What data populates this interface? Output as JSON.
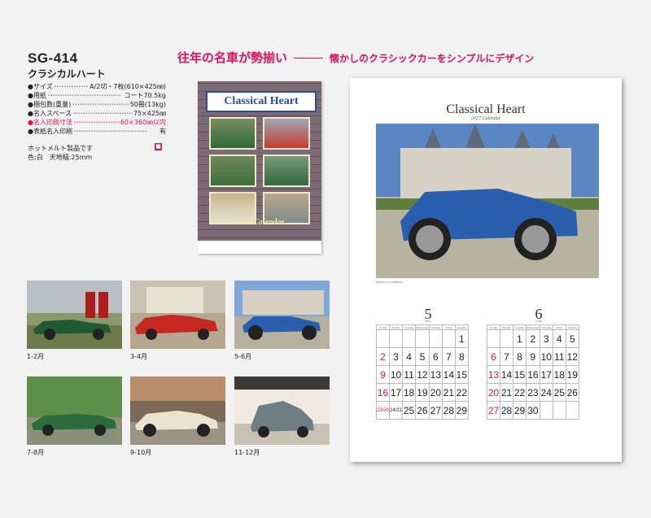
{
  "product": {
    "code": "SG-414",
    "name": "クラシカルハート"
  },
  "specs": [
    {
      "k": "●サイズ",
      "v": "A/2切・7枚(610×425㎜)",
      "pink": false
    },
    {
      "k": "●用紙",
      "v": "コート70.5kg",
      "pink": false
    },
    {
      "k": "●梱包数(重量)",
      "v": "50冊(13kg)",
      "pink": false
    },
    {
      "k": "●名入スペース",
      "v": "75×425㎜",
      "pink": false
    },
    {
      "k": "●名入印刷寸法",
      "v": "60×360㎜以内",
      "pink": true
    },
    {
      "k": "●表紙名入印刷",
      "v": "有",
      "pink": false
    }
  ],
  "notes": {
    "line1": "ホットメルト製品です",
    "line2": "色:白　天地幅:25mm",
    "tag": "■"
  },
  "headline": {
    "main": "往年の名車が勢揃い",
    "sub": "懐かしのクラシックカーをシンプルにデザイン"
  },
  "cover": {
    "title": "Classical Heart",
    "year": "2027 Calendar"
  },
  "thumbs": [
    "1-2月",
    "3-4月",
    "5-6月",
    "7-8月",
    "9-10月",
    "11-12月"
  ],
  "calendar": {
    "title": "Classical Heart",
    "subtitle": "2027 Calendar",
    "caption_left": "BUGATTI T35 BRESCIA",
    "caption_right": "",
    "weekdays": [
      "Sunday",
      "Monday",
      "Tuesday",
      "Wednesday",
      "Thursday",
      "Friday",
      "Saturday"
    ],
    "may": {
      "num": "5",
      "label": "MAY",
      "rows": [
        [
          "",
          "",
          "",
          "",
          "",
          "",
          "1"
        ],
        [
          "2",
          "3",
          "4",
          "5",
          "6",
          "7",
          "8"
        ],
        [
          "9",
          "10",
          "11",
          "12",
          "13",
          "14",
          "15"
        ],
        [
          "16",
          "17",
          "18",
          "19",
          "20",
          "21",
          "22"
        ],
        [
          "23/30",
          "24/31",
          "25",
          "26",
          "27",
          "28",
          "29"
        ]
      ]
    },
    "june": {
      "num": "6",
      "label": "JUNE",
      "rows": [
        [
          "",
          "",
          "1",
          "2",
          "3",
          "4",
          "5"
        ],
        [
          "6",
          "7",
          "8",
          "9",
          "10",
          "11",
          "12"
        ],
        [
          "13",
          "14",
          "15",
          "16",
          "17",
          "18",
          "19"
        ],
        [
          "20",
          "21",
          "22",
          "23",
          "24",
          "25",
          "26"
        ],
        [
          "27",
          "28",
          "29",
          "30",
          "",
          "",
          ""
        ]
      ]
    }
  },
  "colors": {
    "accent": "#e0115f",
    "car_blue": "#2a5fb0"
  }
}
